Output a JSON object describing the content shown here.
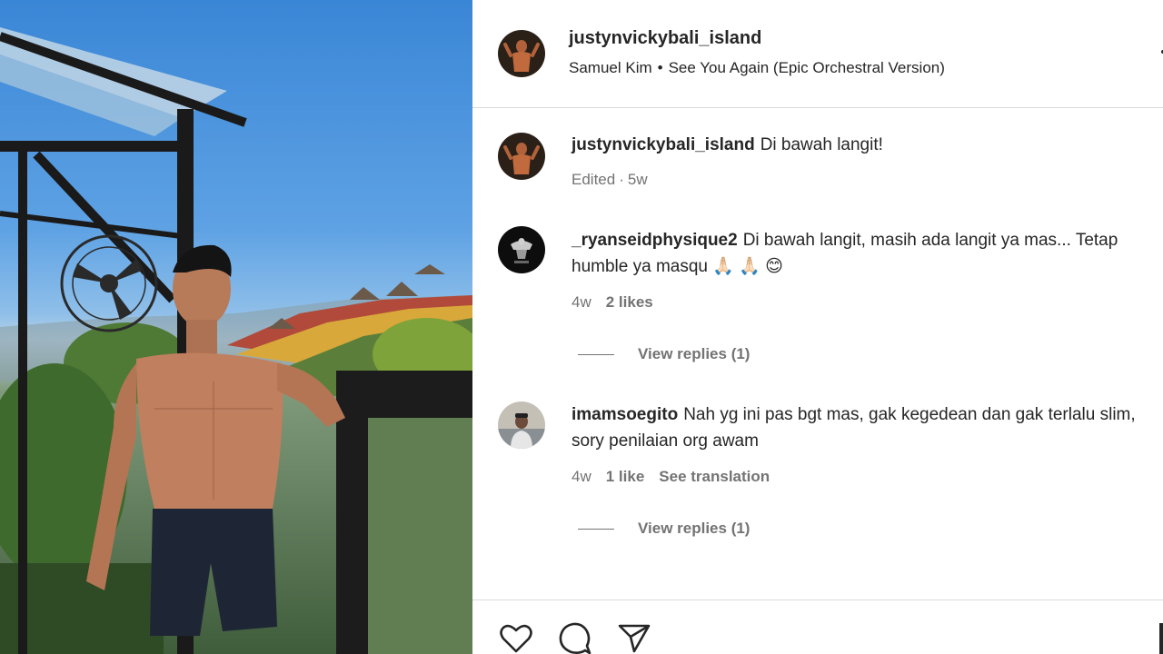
{
  "post": {
    "username": "justynvickybali_island",
    "audio_artist": "Samuel Kim",
    "audio_separator": "•",
    "audio_title": "See You Again (Epic Orchestral Version)"
  },
  "comments": [
    {
      "username": "justynvickybali_island",
      "text": "Di bawah langit!",
      "meta_edited": "Edited",
      "meta_sep": "·",
      "meta_time": "5w"
    },
    {
      "username": "_ryanseidphysique2",
      "text": "Di bawah langit, masih ada langit ya mas... Tetap humble ya masqu 🙏🏻 🙏🏻 😊",
      "time": "4w",
      "likes": "2 likes",
      "view_replies": "View replies (1)"
    },
    {
      "username": "imamsoegito",
      "text": "Nah yg ini pas bgt mas, gak kegedean dan gak terlalu slim, sory penilaian org awam",
      "time": "4w",
      "likes": "1 like",
      "translation": "See translation",
      "view_replies": "View replies (1)"
    }
  ],
  "actions": {
    "like_icon": "heart-icon",
    "comment_icon": "comment-bubble-icon",
    "share_icon": "paper-plane-icon"
  },
  "colors": {
    "text": "#262626",
    "secondary": "#737373",
    "divider": "#dbdbdb"
  }
}
